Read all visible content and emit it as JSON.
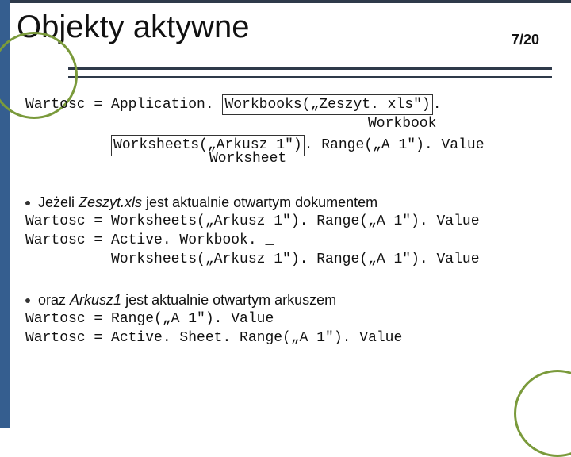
{
  "page": {
    "title": "Objekty aktywne",
    "pagenum": "7/20"
  },
  "code": {
    "line1_a": "Wartosc = Application. ",
    "line1_box": "Workbooks(„Zeszyt. xls\")",
    "line1_b": ". _",
    "label1": "Workbook",
    "line2_a": "          ",
    "line2_box": "Worksheets(„Arkusz 1\")",
    "line2_b": ". Range(„A 1\"). Value",
    "label2": "Worksheet"
  },
  "sect1": {
    "bullet_a": "Jeżeli ",
    "bullet_i": "Zeszyt.xls",
    "bullet_b": " jest aktualnie otwartym dokumentem",
    "l1": "Wartosc = Worksheets(„Arkusz 1\"). Range(„A 1\"). Value",
    "l2": "Wartosc = Active. Workbook. _",
    "l3": "          Worksheets(„Arkusz 1\"). Range(„A 1\"). Value"
  },
  "sect2": {
    "bullet_a": "oraz  ",
    "bullet_i": "Arkusz1",
    "bullet_b": " jest aktualnie otwartym arkuszem",
    "l1": "Wartosc = Range(„A 1\"). Value",
    "l2": "Wartosc = Active. Sheet. Range(„A 1\"). Value"
  }
}
